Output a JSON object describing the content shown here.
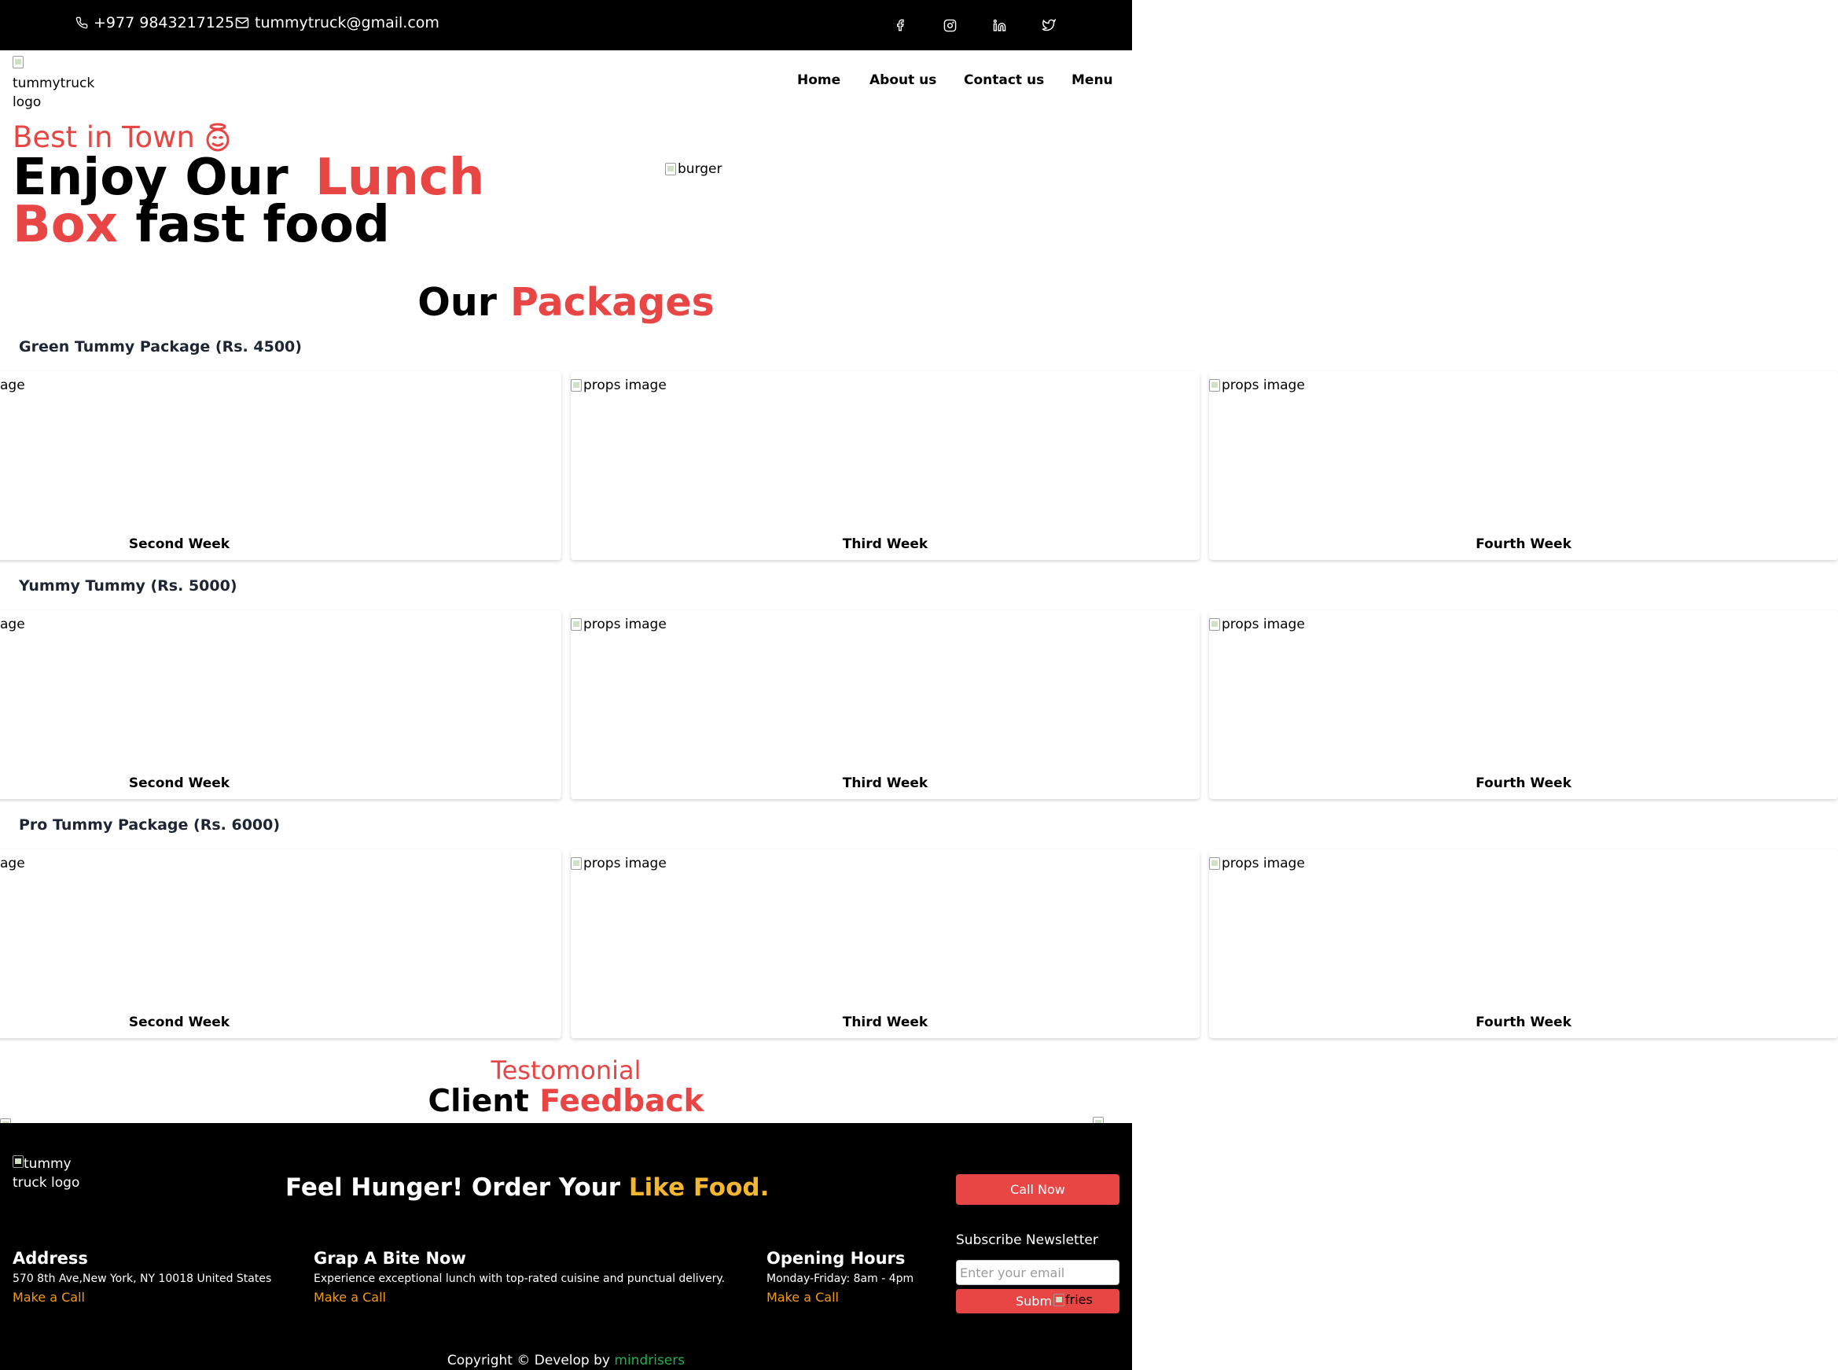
{
  "topbar": {
    "phone": "+977 9843217125",
    "email": "tummytruck@gmail.com",
    "social": [
      {
        "icon": "facebook-icon"
      },
      {
        "icon": "instagram-icon"
      },
      {
        "icon": "linkedin-icon"
      },
      {
        "icon": "twitter-icon"
      }
    ]
  },
  "navbar": {
    "logo_alt": "tummytruck logo",
    "links": [
      "Home",
      "About us",
      "Contact us",
      "Menu"
    ]
  },
  "hero": {
    "tagline": "Best in Town",
    "tagline_icon": "smiling-face-icon",
    "headline_1": "Enjoy Our",
    "headline_highlight_1": "Lunch",
    "headline_highlight_2": "Box",
    "headline_2": "fast food",
    "image_alt": "burger"
  },
  "packages": {
    "title_1": "Our",
    "title_highlight": "Packages",
    "groups": [
      {
        "name": "Green Tummy Package (Rs. 4500)",
        "cards": [
          {
            "image_alt": "age",
            "week": "Second Week"
          },
          {
            "image_alt": "props image",
            "week": "Third Week"
          },
          {
            "image_alt": "props image",
            "week": "Fourth Week"
          }
        ]
      },
      {
        "name": "Yummy Tummy (Rs. 5000)",
        "cards": [
          {
            "image_alt": "age",
            "week": "Second Week"
          },
          {
            "image_alt": "props image",
            "week": "Third Week"
          },
          {
            "image_alt": "props image",
            "week": "Fourth Week"
          }
        ]
      },
      {
        "name": "Pro Tummy Package (Rs. 6000)",
        "cards": [
          {
            "image_alt": "age",
            "week": "Second Week"
          },
          {
            "image_alt": "props image",
            "week": "Third Week"
          },
          {
            "image_alt": "props image",
            "week": "Fourth Week"
          }
        ]
      }
    ]
  },
  "testimonial": {
    "subtitle": "Testomonial",
    "title_1": "Client",
    "title_highlight": "Feedback"
  },
  "footer": {
    "logo_alt": "tummy truck logo",
    "cta_1": "Feel Hunger! Order Your",
    "cta_highlight": "Like Food.",
    "call_now": "Call Now",
    "columns": [
      {
        "heading": "Address",
        "text": "570 8th Ave,New York, NY 10018 United States",
        "link": "Make a Call"
      },
      {
        "heading": "Grap A Bite Now",
        "text": "Experience exceptional lunch with top-rated cuisine and punctual delivery.",
        "link": "Make a Call"
      },
      {
        "heading": "Opening Hours",
        "text": "Monday-Friday: 8am - 4pm",
        "link": "Make a Call"
      }
    ],
    "newsletter_label": "Subscribe Newsletter",
    "newsletter_placeholder": "Enter your email",
    "submit": "Subm",
    "fries_alt": "fries",
    "copyright": "Copyright © Develop by",
    "developer": "mindrisers"
  },
  "colors": {
    "accent_red": "#e84545",
    "footer_gold": "#f3b631",
    "link_orange": "#f39c12",
    "developer_green": "#23b04f"
  }
}
